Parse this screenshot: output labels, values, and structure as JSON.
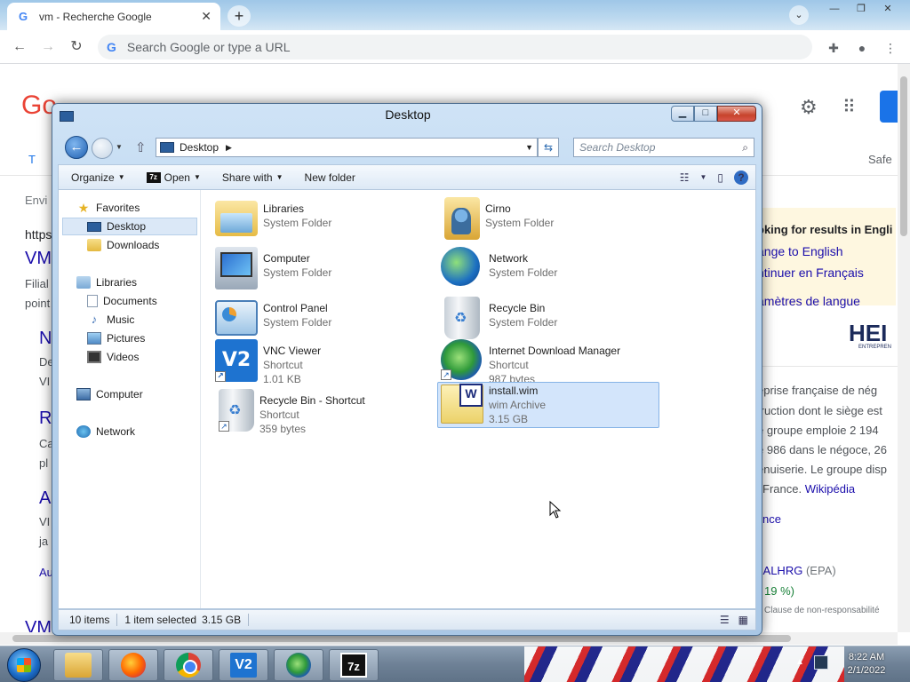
{
  "chrome": {
    "tab_title": "vm - Recherche Google",
    "tab_close": "✕",
    "new_tab": "+",
    "omnibox_placeholder": "Search Google or type a URL",
    "window_controls": [
      "—",
      "❐",
      "✕"
    ]
  },
  "google_page": {
    "logo_fragment": "Go",
    "tab_fragment": "T",
    "safe": "Safe",
    "envi": "Envi",
    "https": "https",
    "vm": "VM",
    "filial": "Filial",
    "point": "point",
    "n": "N",
    "de": "De",
    "vi": "VI",
    "r": "R",
    "ca": "Ca",
    "pl": "pl",
    "a": "A",
    "vi2": "VI",
    "ja": "ja",
    "au": "Au",
    "vm_bottom": "VM",
    "kp_heading": "oking for results in Engli",
    "kp_link1": "ange to English",
    "kp_link2": "ntinuer en Français",
    "kp_link3": "amètres de langue",
    "kp_logo": "HEI",
    "kp_logo_sub": "ENTREPREN",
    "kp_line1": "eprise française de nég",
    "kp_line2": "truction dont le siège est",
    "kp_line3": "e groupe emploie 2 194",
    "kp_line4": "e 986 dans le négoce, 26",
    "kp_line5": "enuiserie. Le groupe disp",
    "kp_line6": "France.",
    "kp_wiki": "Wikipédia",
    "kp_nce": "nce",
    "kp_stock_label": ":",
    "kp_stock": "ALHRG",
    "kp_stock_exchange": "(EPA)",
    "kp_change": "19 %)",
    "kp_disclaimer": "Clause de non-responsabilité"
  },
  "explorer": {
    "title": "Desktop",
    "address": "Desktop",
    "search_placeholder": "Search Desktop",
    "commands": {
      "organize": "Organize",
      "open": "Open",
      "share_with": "Share with",
      "new_folder": "New folder"
    },
    "nav": {
      "favorites": "Favorites",
      "desktop": "Desktop",
      "downloads": "Downloads",
      "libraries": "Libraries",
      "documents": "Documents",
      "music": "Music",
      "pictures": "Pictures",
      "videos": "Videos",
      "computer": "Computer",
      "network": "Network"
    },
    "items": [
      {
        "name": "Libraries",
        "line2": "System Folder",
        "line3": "",
        "icon": "libraries-icon"
      },
      {
        "name": "Cirno",
        "line2": "System Folder",
        "line3": "",
        "icon": "user-folder-icon"
      },
      {
        "name": "Computer",
        "line2": "System Folder",
        "line3": "",
        "icon": "computer-icon"
      },
      {
        "name": "Network",
        "line2": "System Folder",
        "line3": "",
        "icon": "network-icon"
      },
      {
        "name": "Control Panel",
        "line2": "System Folder",
        "line3": "",
        "icon": "control-panel-icon"
      },
      {
        "name": "Recycle Bin",
        "line2": "System Folder",
        "line3": "",
        "icon": "recycle-bin-icon"
      },
      {
        "name": "VNC Viewer",
        "line2": "Shortcut",
        "line3": "1.01 KB",
        "icon": "vnc-viewer-icon"
      },
      {
        "name": "Internet Download Manager",
        "line2": "Shortcut",
        "line3": "987 bytes",
        "icon": "idm-icon"
      },
      {
        "name": "Recycle Bin - Shortcut",
        "line2": "Shortcut",
        "line3": "359 bytes",
        "icon": "recycle-bin-icon"
      },
      {
        "name": "install.wim",
        "line2": "wim Archive",
        "line3": "3.15 GB",
        "icon": "wim-archive-icon"
      }
    ],
    "selected_item": "install.wim",
    "status": {
      "count": "10 items",
      "selection": "1 item selected",
      "size": "3.15 GB"
    }
  },
  "taskbar": {
    "clock_time": "8:22 AM",
    "clock_date": "2/1/2022",
    "vnc_glyph": "V2",
    "sevenzip_glyph": "7z"
  }
}
